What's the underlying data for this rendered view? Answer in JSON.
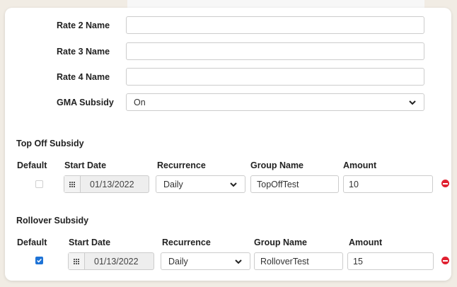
{
  "rate_fields": [
    {
      "label": "Rate 2 Name",
      "value": ""
    },
    {
      "label": "Rate 3 Name",
      "value": ""
    },
    {
      "label": "Rate 4 Name",
      "value": ""
    }
  ],
  "gma_subsidy": {
    "label": "GMA Subsidy",
    "value": "On"
  },
  "columns": {
    "default": "Default",
    "start_date": "Start Date",
    "recurrence": "Recurrence",
    "group_name": "Group Name",
    "amount": "Amount"
  },
  "top_off": {
    "title": "Top Off Subsidy",
    "default_checked": false,
    "start_date": "01/13/2022",
    "recurrence": "Daily",
    "group_name": "TopOffTest",
    "amount": "10"
  },
  "rollover": {
    "title": "Rollover Subsidy",
    "default_checked": true,
    "start_date": "01/13/2022",
    "recurrence": "Daily",
    "group_name": "RolloverTest",
    "amount": "15"
  },
  "colors": {
    "accent": "#1e73d6",
    "danger": "#e02030",
    "border": "#cccccc"
  },
  "icons": [
    "calendar-icon",
    "chevron-down-icon",
    "remove-icon",
    "checkbox-icon"
  ]
}
